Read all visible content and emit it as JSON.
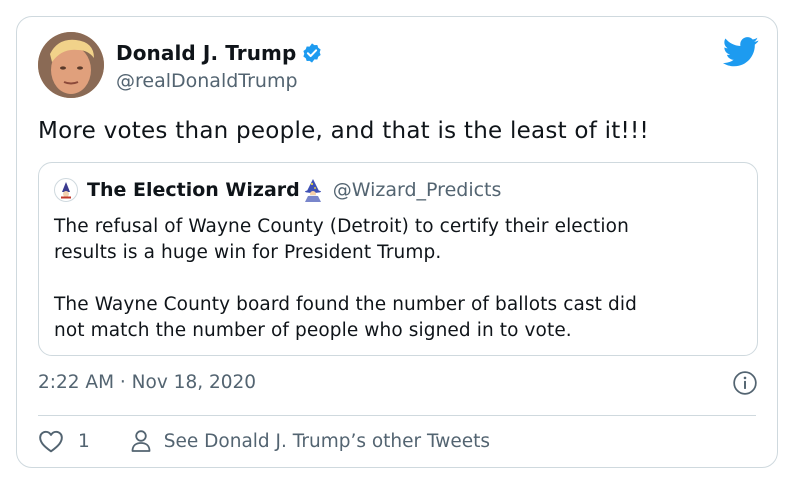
{
  "tweet": {
    "author": {
      "name": "Donald J. Trump",
      "handle": "@realDonaldTrump",
      "verified": true
    },
    "text": "More votes than people, and that is the least of it!!!",
    "quoted_tweet": {
      "author": {
        "name": "The Election Wizard",
        "handle": "@Wizard_Predicts",
        "name_icon": "wizard-icon"
      },
      "text": "The refusal of Wayne County (Detroit) to certify their election\nresults is a huge win for President Trump.\n\nThe Wayne County board found the number of ballots cast did\nnot match the number of people who signed in to vote."
    },
    "timestamp": "2:22 AM · Nov 18, 2020",
    "actions": {
      "like_count": "1",
      "more_tweets_label": "See Donald J. Trump’s other Tweets"
    }
  },
  "icons": [
    "verified-badge-icon",
    "twitter-bird-icon",
    "wizard-icon",
    "info-icon",
    "heart-icon",
    "person-icon"
  ],
  "colors": {
    "brand_blue": "#1d9bf0",
    "text": "#0f1419",
    "secondary_text": "#536471",
    "border": "#cfd9de"
  }
}
